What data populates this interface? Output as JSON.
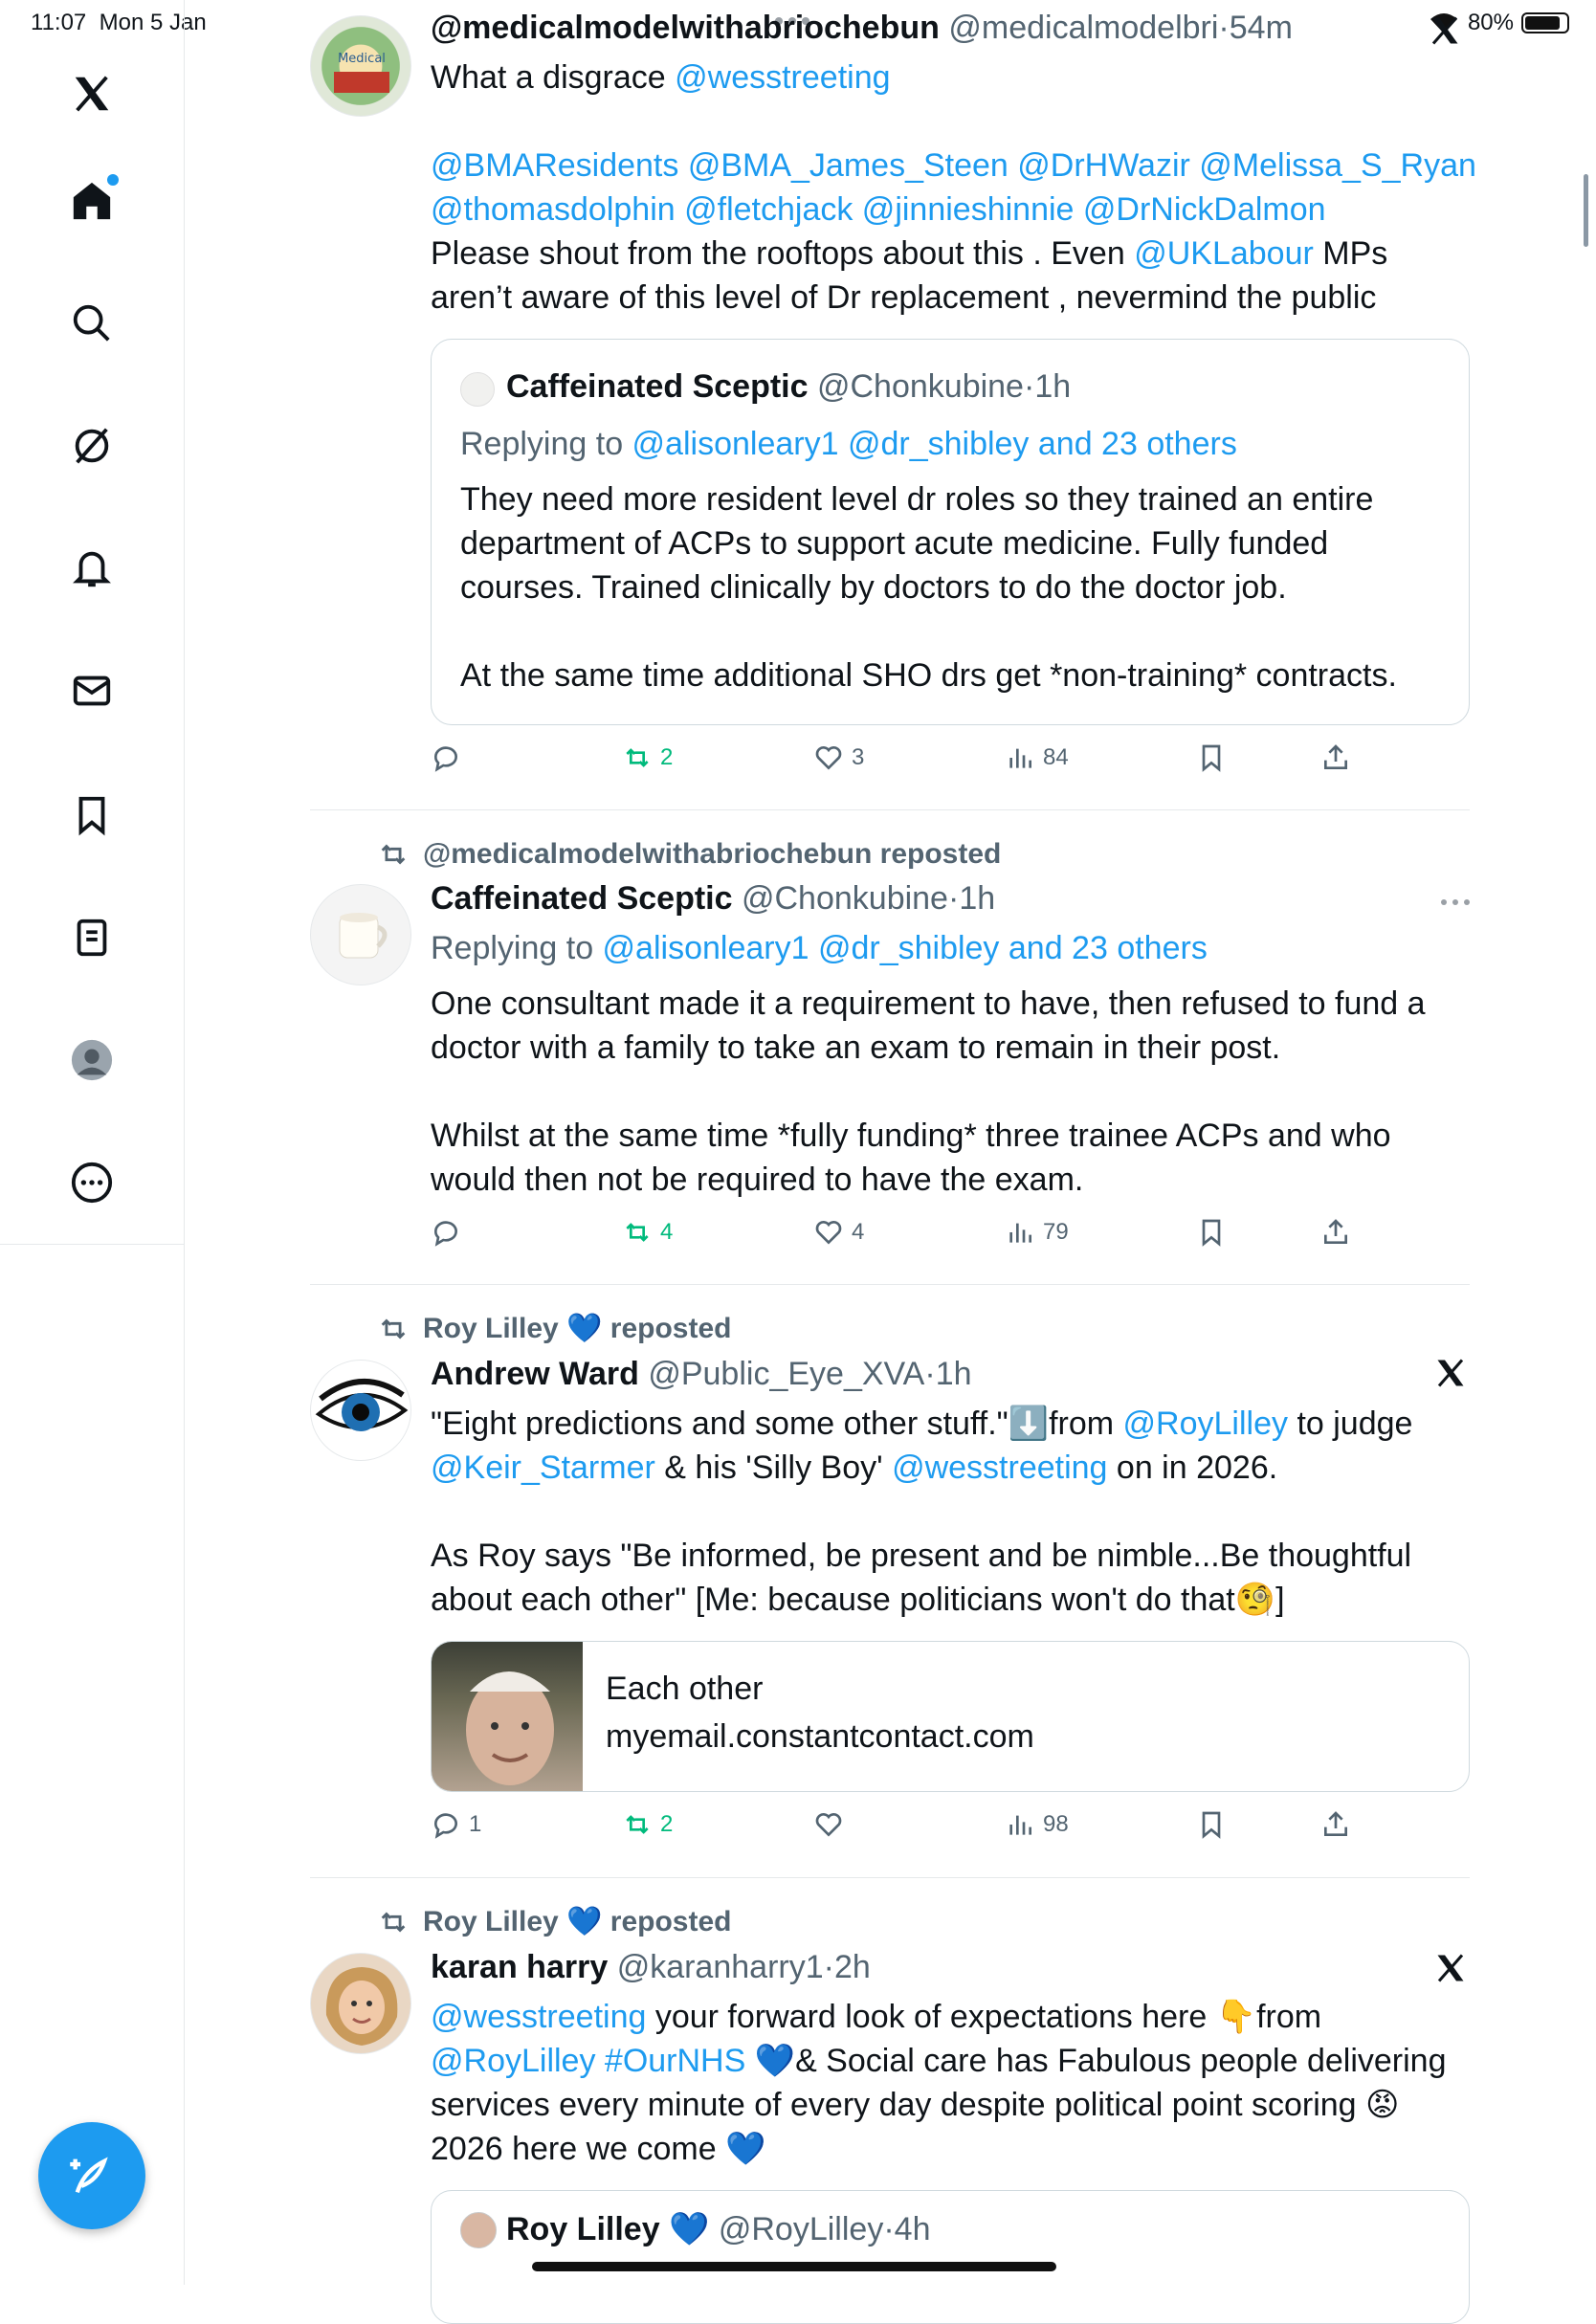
{
  "status_bar": {
    "time": "11:07",
    "date": "Mon 5 Jan",
    "battery": "80%"
  },
  "colors": {
    "accent": "#1d9bf0",
    "repost_green": "#00ba7c",
    "muted": "#536471"
  },
  "sidebar": {
    "items": [
      {
        "icon": "x-logo-icon"
      },
      {
        "icon": "home-icon"
      },
      {
        "icon": "search-icon"
      },
      {
        "icon": "grok-icon"
      },
      {
        "icon": "bell-icon"
      },
      {
        "icon": "mail-icon"
      },
      {
        "icon": "bookmark-icon"
      },
      {
        "icon": "list-icon"
      },
      {
        "icon": "profile-icon"
      },
      {
        "icon": "more-icon"
      }
    ],
    "compose_icon": "compose-icon"
  },
  "tweets": [
    {
      "name": "@medicalmodelwithabriochebun",
      "handle": "@medicalmodelbri",
      "time": "54m",
      "body": {
        "l1a": "What a disgrace ",
        "l1b": "@wesstreeting",
        "l2": "@BMAResidents @BMA_James_Steen @DrHWazir @Melissa_S_Ryan",
        "l3": "@thomasdolphin @fletchjack @jinnieshinnie @DrNickDalmon",
        "l4a": "Please shout from the rooftops about this . Even  ",
        "l4b": "@UKLabour",
        "l4c": " MPs",
        "l5": "aren’t aware of this level of Dr replacement , nevermind the public"
      },
      "quote": {
        "name": "Caffeinated Sceptic",
        "handle": "@Chonkubine",
        "time": "1h",
        "replying_to": "Replying to ",
        "replying_links": "@alisonleary1 @dr_shibley and 23 others",
        "l1": "They need more resident level dr roles so they trained an entire",
        "l2": "department of ACPs to support acute medicine. Fully funded",
        "l3": "courses. Trained clinically by doctors to do the doctor job.",
        "l4": "At the same time additional SHO drs get *non-training* contracts."
      },
      "stats": {
        "replies": "",
        "reposts": "2",
        "likes": "3",
        "views": "84"
      }
    },
    {
      "repost_by": "@medicalmodelwithabriochebun reposted",
      "name": "Caffeinated Sceptic",
      "handle": "@Chonkubine",
      "time": "1h",
      "replying_to": "Replying to ",
      "replying_links": "@alisonleary1 @dr_shibley and 23 others",
      "body": {
        "l1": "One consultant made it a requirement to have, then refused to fund a",
        "l2": "doctor with a family to take an exam to remain in their post.",
        "l3": "Whilst at the same time *fully funding* three trainee ACPs and who",
        "l4": "would then not be required to have the exam."
      },
      "stats": {
        "replies": "",
        "reposts": "4",
        "likes": "4",
        "views": "79"
      }
    },
    {
      "repost_by_name": "Roy Lilley",
      "repost_by_emoji": "💙",
      "repost_by_suffix": "reposted",
      "name": "Andrew Ward",
      "handle": "@Public_Eye_XVA",
      "time": "1h",
      "body": {
        "l1a": "\"Eight predictions and some other stuff.\"",
        "l1b": "⬇️",
        "l1c": "from ",
        "l1d": "@RoyLilley",
        "l1e": " to judge",
        "l2a": "@Keir_Starmer",
        "l2b": " & his 'Silly Boy' ",
        "l2c": "@wesstreeting",
        "l2d": " on in 2026.",
        "l3": "As Roy says \"Be informed, be present and be nimble...Be thoughtful",
        "l4a": "about each other\" [Me: because politicians won't do that",
        "l4b": "🧐",
        "l4c": "]"
      },
      "card": {
        "title": "Each other",
        "domain": "myemail.constantcontact.com"
      },
      "stats": {
        "replies": "1",
        "reposts": "2",
        "likes": "",
        "views": "98"
      }
    },
    {
      "repost_by_name": "Roy Lilley",
      "repost_by_emoji": "💙",
      "repost_by_suffix": "reposted",
      "name": "karan harry",
      "handle": "@karanharry1",
      "time": "2h",
      "body": {
        "l1a": "@wesstreeting",
        "l1b": " your forward look of expectations here ",
        "l1c": "👇",
        "l1d": "from",
        "l2a": "@RoyLilley #OurNHS",
        "l2b": " 💙",
        "l2c": "& Social care has Fabulous people delivering",
        "l3a": "services every minute of every day despite political point scoring ",
        "l3b": "😡",
        "l4a": "2026 here we come ",
        "l4b": "💙"
      },
      "quote": {
        "name": "Roy Lilley",
        "emoji": "💙",
        "handle": "@RoyLilley",
        "time": "4h"
      }
    }
  ]
}
